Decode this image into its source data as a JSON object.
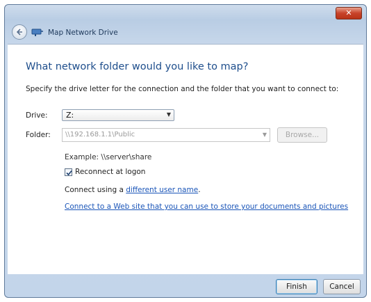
{
  "window": {
    "title": "Map Network Drive",
    "close_label": "✕"
  },
  "main": {
    "heading": "What network folder would you like to map?",
    "instruction": "Specify the drive letter for the connection and the folder that you want to connect to:",
    "drive": {
      "label": "Drive:",
      "value": "Z:"
    },
    "folder": {
      "label": "Folder:",
      "value": "\\\\192.168.1.1\\Public",
      "browse_label": "Browse..."
    },
    "example": "Example: \\\\server\\share",
    "reconnect": {
      "label": "Reconnect at logon",
      "checked": true
    },
    "connect_prefix": "Connect using a ",
    "connect_link": "different user name",
    "connect_suffix": ".",
    "web_link": "Connect to a Web site that you can use to store your documents and pictures"
  },
  "footer": {
    "finish_label": "Finish",
    "cancel_label": "Cancel"
  },
  "colors": {
    "heading": "#1e4e8c",
    "link": "#1a55b8",
    "frame": "#c3d5ea"
  }
}
